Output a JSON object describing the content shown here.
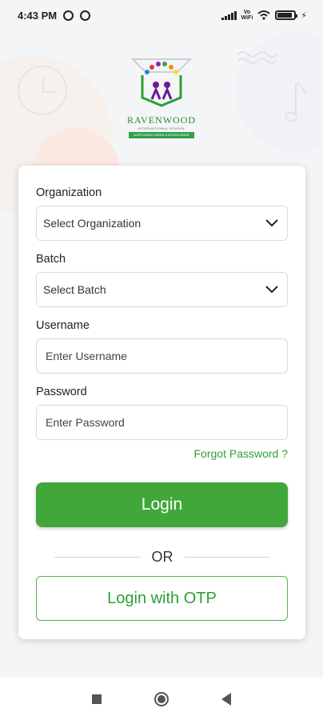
{
  "status_bar": {
    "time": "4:43 PM",
    "vowifi_top": "Vo",
    "vowifi_bottom": "WiFi",
    "battery_level": 0.9
  },
  "logo": {
    "name": "RAVENWOOD",
    "subtitle": "INTERNATIONAL SCHOOL",
    "ribbon": "NURTURING MINDS & EXCELLENCE"
  },
  "form": {
    "organization": {
      "label": "Organization",
      "value": "Select Organization"
    },
    "batch": {
      "label": "Batch",
      "value": "Select Batch"
    },
    "username": {
      "label": "Username",
      "placeholder": "Enter Username"
    },
    "password": {
      "label": "Password",
      "placeholder": "Enter Password"
    },
    "forgot_password": "Forgot Password ?",
    "login_label": "Login",
    "or_text": "OR",
    "otp_label": "Login with OTP"
  },
  "colors": {
    "primary_green": "#42a73a",
    "link_green": "#2e9e35"
  },
  "nav_bar": {
    "recents": "square-icon",
    "home": "circle-home-icon",
    "back": "triangle-back-icon"
  }
}
